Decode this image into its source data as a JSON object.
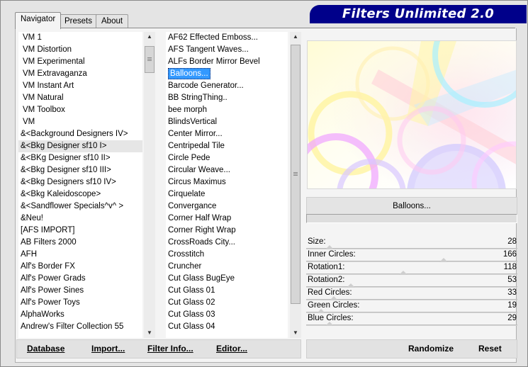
{
  "app": {
    "title": "Filters Unlimited 2.0"
  },
  "tabs": [
    {
      "label": "Navigator",
      "active": true
    },
    {
      "label": "Presets",
      "active": false
    },
    {
      "label": "About",
      "active": false
    }
  ],
  "categories": [
    "VM 1",
    "VM Distortion",
    "VM Experimental",
    "VM Extravaganza",
    "VM Instant Art",
    "VM Natural",
    "VM Toolbox",
    "VM",
    "&<Background Designers IV>",
    "&<Bkg Designer sf10 I>",
    "&<BKg Designer sf10 II>",
    "&<Bkg Designer sf10 III>",
    "&<Bkg Designers sf10 IV>",
    "&<Bkg Kaleidoscope>",
    "&<Sandflower Specials^v^ >",
    "&Neu!",
    "[AFS IMPORT]",
    "AB Filters 2000",
    "AFH",
    "Alf's Border FX",
    "Alf's Power Grads",
    "Alf's Power Sines",
    "Alf's Power Toys",
    "AlphaWorks",
    "Andrew's Filter Collection 55"
  ],
  "selected_category_index": 9,
  "filters": [
    "AF62 Effected Emboss...",
    "AFS Tangent Waves...",
    "ALFs Border Mirror Bevel",
    "Balloons...",
    "Barcode Generator...",
    "BB StringThing..",
    "bee morph",
    "BlindsVertical",
    "Center Mirror...",
    "Centripedal Tile",
    "Circle Pede",
    "Circular Weave...",
    "Circus Maximus",
    "Cirquelate",
    "Convergance",
    "Corner Half Wrap",
    "Corner Right Wrap",
    "CrossRoads City...",
    "Crosstitch",
    "Cruncher",
    "Cut Glass  BugEye",
    "Cut Glass 01",
    "Cut Glass 02",
    "Cut Glass 03",
    "Cut Glass 04"
  ],
  "selected_filter_index": 3,
  "current_filter_name": "Balloons...",
  "parameters": [
    {
      "name": "Size:",
      "value": "28",
      "level": 0.11
    },
    {
      "name": "Inner Circles:",
      "value": "166",
      "level": 0.65
    },
    {
      "name": "Rotation1:",
      "value": "118",
      "level": 0.46
    },
    {
      "name": "Rotation2:",
      "value": "53",
      "level": 0.21
    },
    {
      "name": "Red Circles:",
      "value": "33",
      "level": 0.13
    },
    {
      "name": "Green Circles:",
      "value": "19",
      "level": 0.07
    },
    {
      "name": "Blue Circles:",
      "value": "29",
      "level": 0.11
    }
  ],
  "buttons": {
    "database": "Database",
    "import": "Import...",
    "filter_info": "Filter Info...",
    "editor": "Editor...",
    "randomize": "Randomize",
    "reset": "Reset"
  },
  "colors": {
    "banner": "#00008a",
    "selection": "#3399ff"
  }
}
